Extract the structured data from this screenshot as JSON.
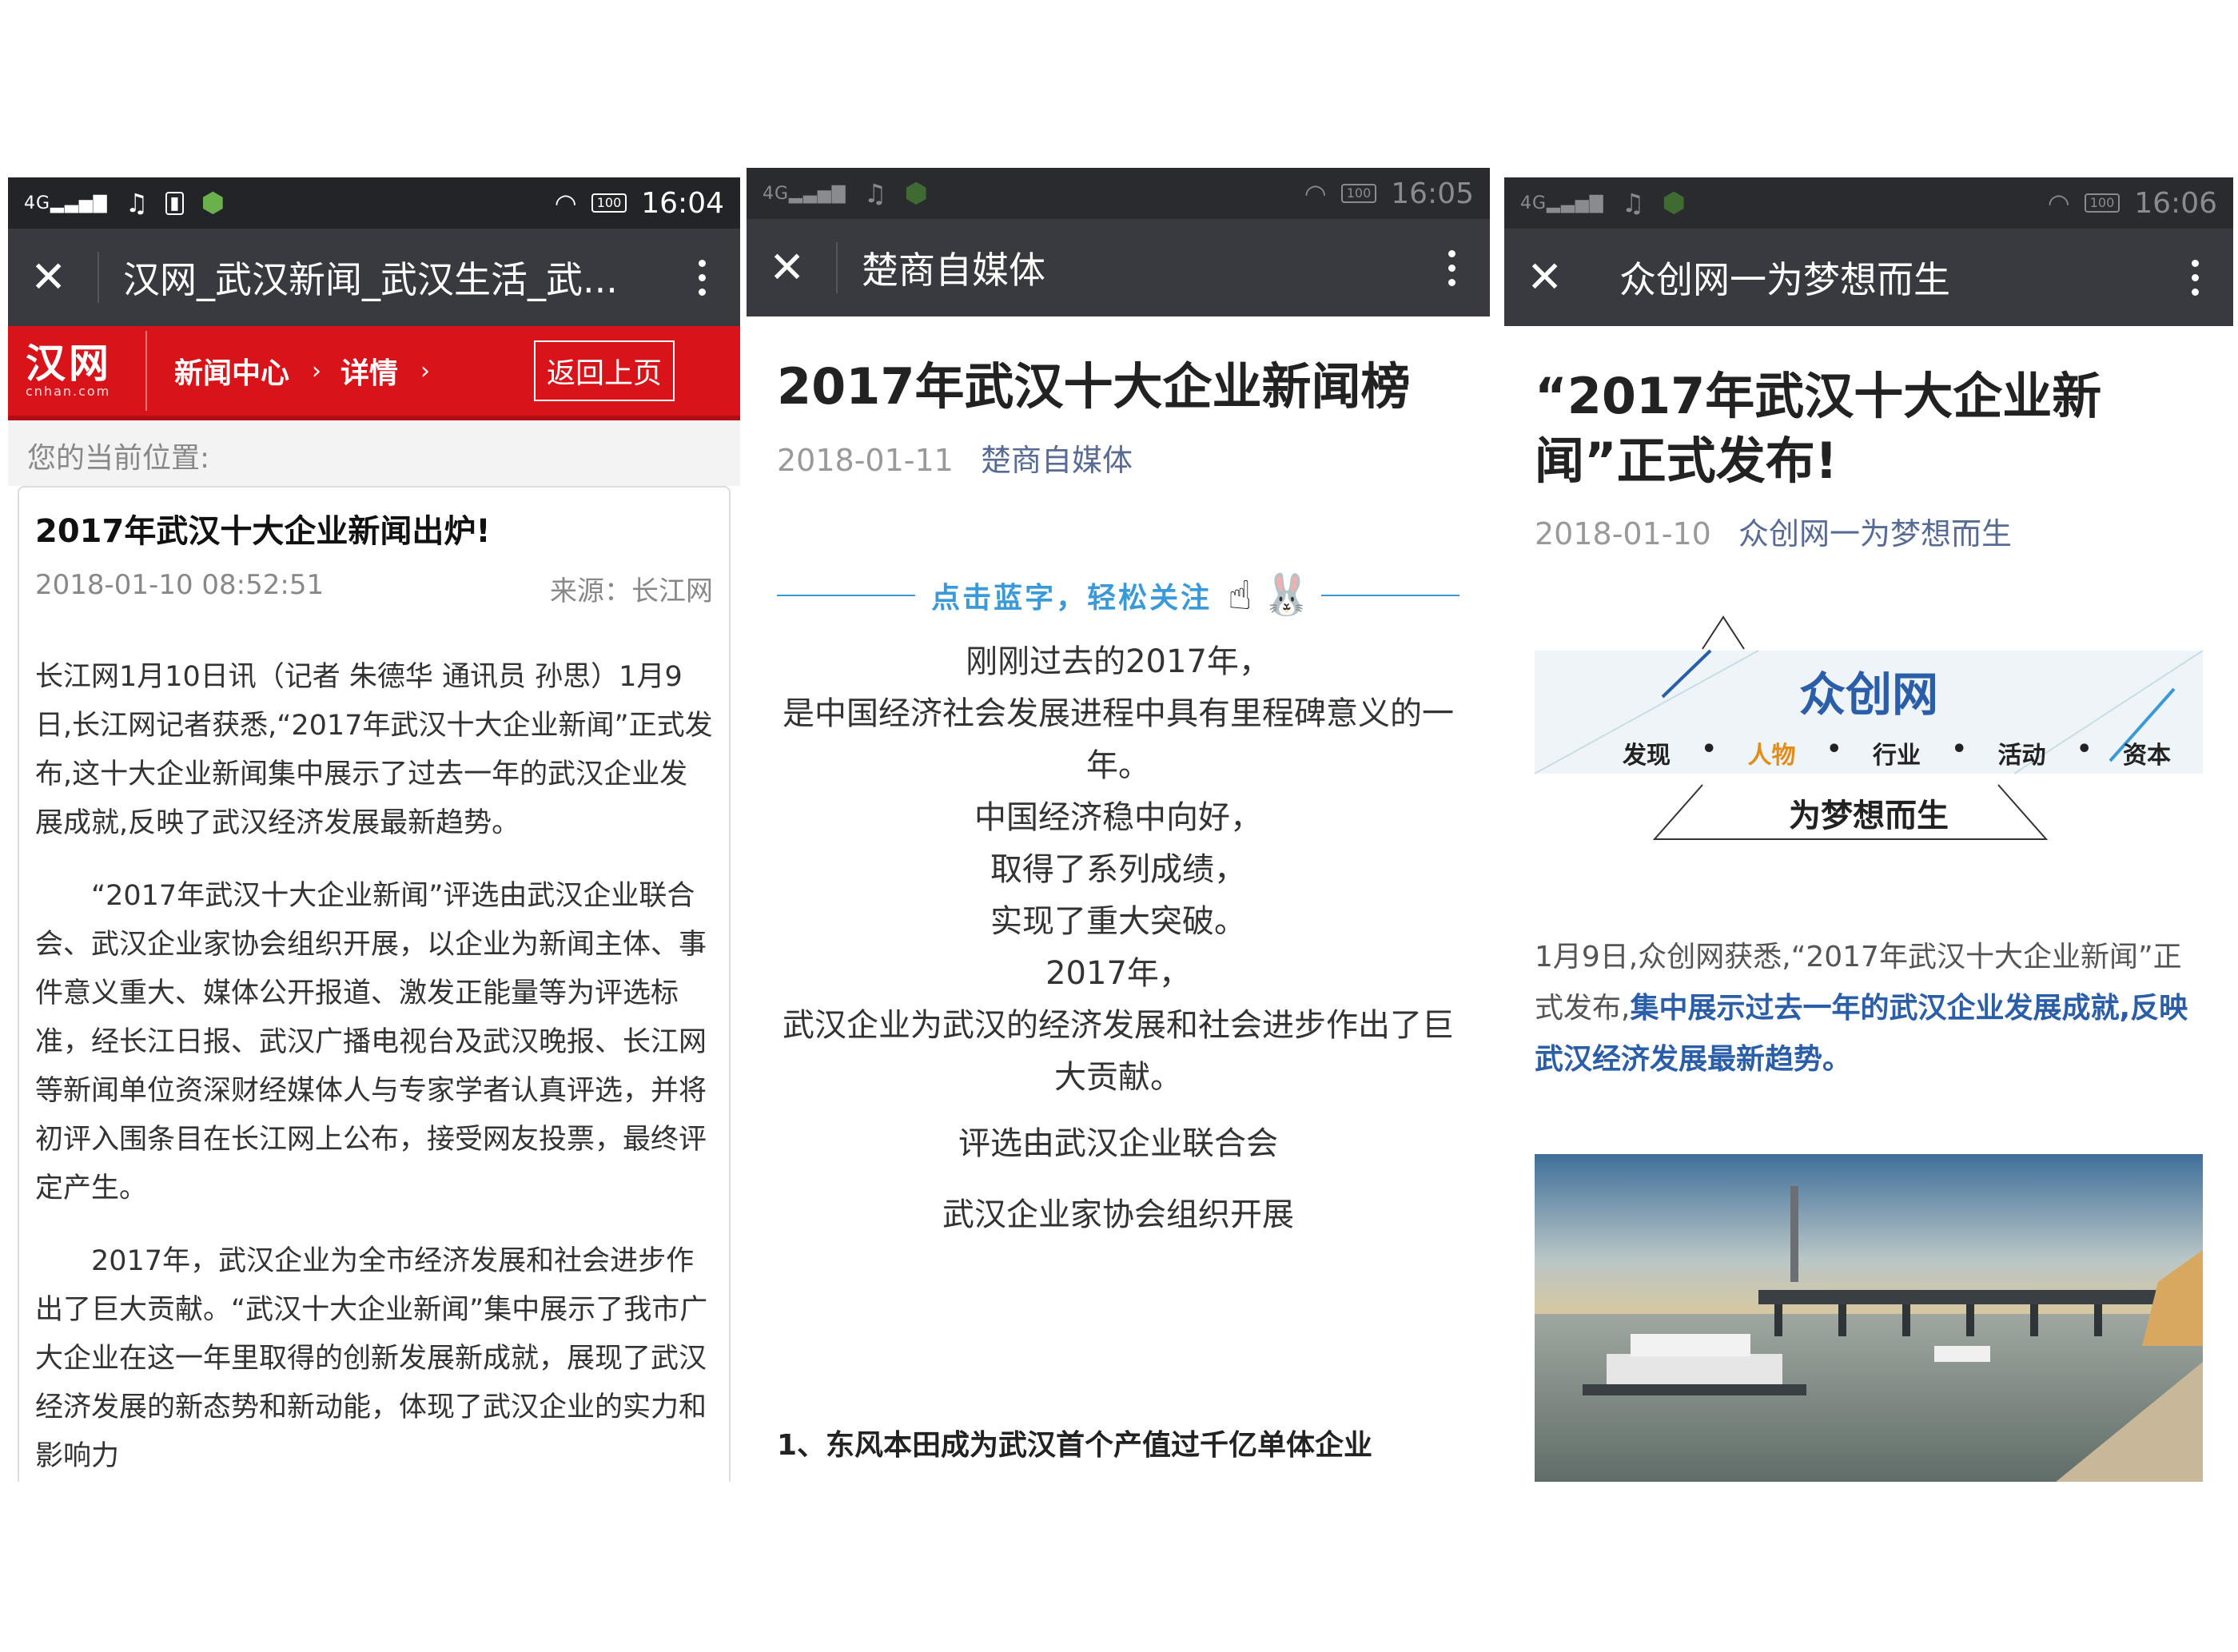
{
  "panel1": {
    "status": {
      "signal": "4G",
      "time": "16:04",
      "battery": "100"
    },
    "titlebar": {
      "title": "汉网_武汉新闻_武汉生活_武..."
    },
    "site": {
      "logo_text": "汉网",
      "logo_sub": "cnhan.com",
      "crumb1": "新闻中心",
      "crumb2": "详情",
      "back_label": "返回上页",
      "location": "您的当前位置:"
    },
    "article": {
      "title": "2017年武汉十大企业新闻出炉!",
      "datetime": "2018-01-10 08:52:51",
      "source": "来源：长江网",
      "para1": "长江网1月10日讯（记者 朱德华 通讯员 孙思）1月9日,长江网记者获悉,“2017年武汉十大企业新闻”正式发布,这十大企业新闻集中展示了过去一年的武汉企业发展成就,反映了武汉经济发展最新趋势。",
      "para2": "“2017年武汉十大企业新闻”评选由武汉企业联合会、武汉企业家协会组织开展，以企业为新闻主体、事件意义重大、媒体公开报道、激发正能量等为评选标准，经长江日报、武汉广播电视台及武汉晚报、长江网等新闻单位资深财经媒体人与专家学者认真评选，并将初评入围条目在长江网上公布，接受网友投票，最终评定产生。",
      "para3": "2017年，武汉企业为全市经济发展和社会进步作出了巨大贡献。“武汉十大企业新闻”集中展示了我市广大企业在这一年里取得的创新发展新成就，展现了武汉经济发展的新态势和新动能，体现了武汉企业的实力和影响力"
    }
  },
  "panel2": {
    "status": {
      "signal": "4G",
      "time": "16:05",
      "battery": "100"
    },
    "titlebar": {
      "title": "楚商自媒体"
    },
    "article": {
      "title": "2017年武汉十大企业新闻榜",
      "date": "2018-01-11",
      "source": "楚商自媒体",
      "follow_text": "点击蓝字，轻松关注",
      "lines": [
        "刚刚过去的2017年，",
        "是中国经济社会发展进程中具有里程碑意义的一年。",
        "中国经济稳中向好，",
        "取得了系列成绩，",
        "实现了重大突破。",
        "2017年，",
        "武汉企业为武汉的经济发展和社会进步作出了巨大贡献。"
      ],
      "lines2": [
        "评选由武汉企业联合会",
        "武汉企业家协会组织开展"
      ],
      "item1": "1、东风本田成为武汉首个产值过千亿单体企业"
    }
  },
  "panel3": {
    "status": {
      "signal": "4G",
      "time": "16:06",
      "battery": "100"
    },
    "titlebar": {
      "title": "众创网一为梦想而生"
    },
    "article": {
      "title": "“2017年武汉十大企业新闻”正式发布!",
      "date": "2018-01-10",
      "source": "众创网一为梦想而生",
      "banner": {
        "brand": "众创网",
        "tags": [
          "发现",
          "人物",
          "行业",
          "活动",
          "资本"
        ],
        "slogan": "为梦想而生"
      },
      "para_plain": "1月9日,众创网获悉,“2017年武汉十大企业新闻”正式发布,",
      "para_highlight": "集中展示过去一年的武汉企业发展成就,反映武汉经济发展最新趋势。"
    }
  },
  "colors": {
    "wechat_bar": "#393a3f",
    "cnhan_red": "#d8141a",
    "link_blue": "#576b95",
    "follow_blue": "#3a9ad9"
  },
  "icons": [
    "signal-icon",
    "music-icon",
    "battery-icon",
    "wifi-icon",
    "close-icon",
    "more-icon",
    "chevron-right-icon",
    "pointing-hand-icon"
  ]
}
